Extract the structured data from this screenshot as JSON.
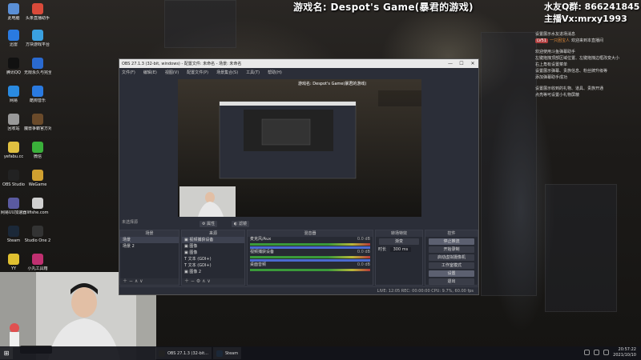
{
  "overlay": {
    "stream_title": "游戏名: Despot's Game(暴君的游戏)",
    "qq_group": "水友Q群: 866241845",
    "anchor_wechat": "主播Vx:mrxy1993"
  },
  "chat": {
    "messages": [
      {
        "text": "设置展示水友进场消息"
      },
      {
        "badge": "LV51",
        "user": "一只困宝人",
        "text": "欢迎来到本直播间"
      },
      {
        "gap": true
      },
      {
        "text": "欢迎使用斗鱼弹幕助手"
      },
      {
        "text": "左键拖拽顶部区域位置、左键拖拽边框改变大小"
      },
      {
        "text": "右上角有设置菜单"
      },
      {
        "text": "设置展示弹幕、贵族信息、粉丝牌升级等"
      },
      {
        "text": "添加弹幕助手成功"
      },
      {
        "gap": true
      },
      {
        "text": "设置展示收到的礼物、道具、贵族开通"
      },
      {
        "text": "点亮等可设置小礼物屏蔽"
      }
    ]
  },
  "desktop_icons": [
    {
      "label": "此电脑",
      "color": "#5a8fd6"
    },
    {
      "label": "头条直播助手",
      "color": "#d94a3a"
    },
    {
      "label": "迅雷",
      "color": "#2a7ae0"
    },
    {
      "label": "方块游戏平台",
      "color": "#3aa0e0"
    },
    {
      "label": "腾讯QQ",
      "color": "#111111"
    },
    {
      "label": "无限永久与完全工具箱",
      "color": "#2a6ad0"
    },
    {
      "label": "网易",
      "color": "#2a8ae0"
    },
    {
      "label": "酷狗音乐",
      "color": "#2a7ae0"
    },
    {
      "label": "回收站",
      "color": "#999999"
    },
    {
      "label": "魔兽争霸官方对战平台",
      "color": "#6a4a2a"
    },
    {
      "label": "yefabu.cc",
      "color": "#e0c040"
    },
    {
      "label": "微信",
      "color": "#3ab03a"
    },
    {
      "label": "OBS Studio",
      "color": "#222222"
    },
    {
      "label": "WeGame",
      "color": "#d0a030"
    },
    {
      "label": "网易UU加速器",
      "color": "#5a5aa0"
    },
    {
      "label": "lifishe.com",
      "color": "#d0d0d0"
    },
    {
      "label": "Steam",
      "color": "#1b2838"
    },
    {
      "label": "Studio One 2",
      "color": "#333333"
    },
    {
      "label": "YY",
      "color": "#e0c030"
    },
    {
      "label": "小丸工具箱",
      "color": "#c03070"
    }
  ],
  "obs": {
    "window_title": "OBS 27.1.3 (32-bit, windows) - 配置文件: 未命名 - 场景: 未命名",
    "menu": [
      "文件(F)",
      "编辑(E)",
      "视图(V)",
      "配置文件(P)",
      "场景集合(S)",
      "工具(T)",
      "帮助(H)"
    ],
    "preview_overlay_title": "游戏名: Despot's Game(暴君的游戏)",
    "no_source": "未选择源",
    "properties_btn": "属性",
    "filters_btn": "滤镜",
    "docks": {
      "scenes": {
        "title": "场景",
        "items": [
          "场景",
          "场景 2"
        ]
      },
      "sources": {
        "title": "来源",
        "items": [
          "视频捕获设备",
          "图像",
          "图像",
          "文本 (GDI+)",
          "文本 (GDI+)",
          "图像 2"
        ]
      },
      "mixer": {
        "title": "混音器",
        "channels": [
          {
            "name": "麦克风/Aux",
            "db": "0.0 dB"
          },
          {
            "name": "视频捕获设备",
            "db": "0.0 dB"
          },
          {
            "name": "桌面音频",
            "db": "0.0 dB"
          }
        ]
      },
      "transitions": {
        "title": "转场特效",
        "type": "渐变",
        "duration_label": "时长",
        "duration": "300 ms"
      },
      "controls": {
        "title": "控件",
        "buttons": [
          "停止推流",
          "开始录制",
          "启动虚拟摄像机",
          "工作室模式",
          "设置",
          "退出"
        ]
      }
    },
    "status": "LIVE: 12:05   REC: 00:00:00   CPU: 9.7%, 60.00 fps"
  },
  "taskbar": {
    "items": [
      {
        "label": "OBS 27.1.3 (32-bit...",
        "color": "#222222"
      },
      {
        "label": "Steam",
        "color": "#1b2838"
      }
    ],
    "time": "20:57:22",
    "date": "2021/10/10"
  }
}
